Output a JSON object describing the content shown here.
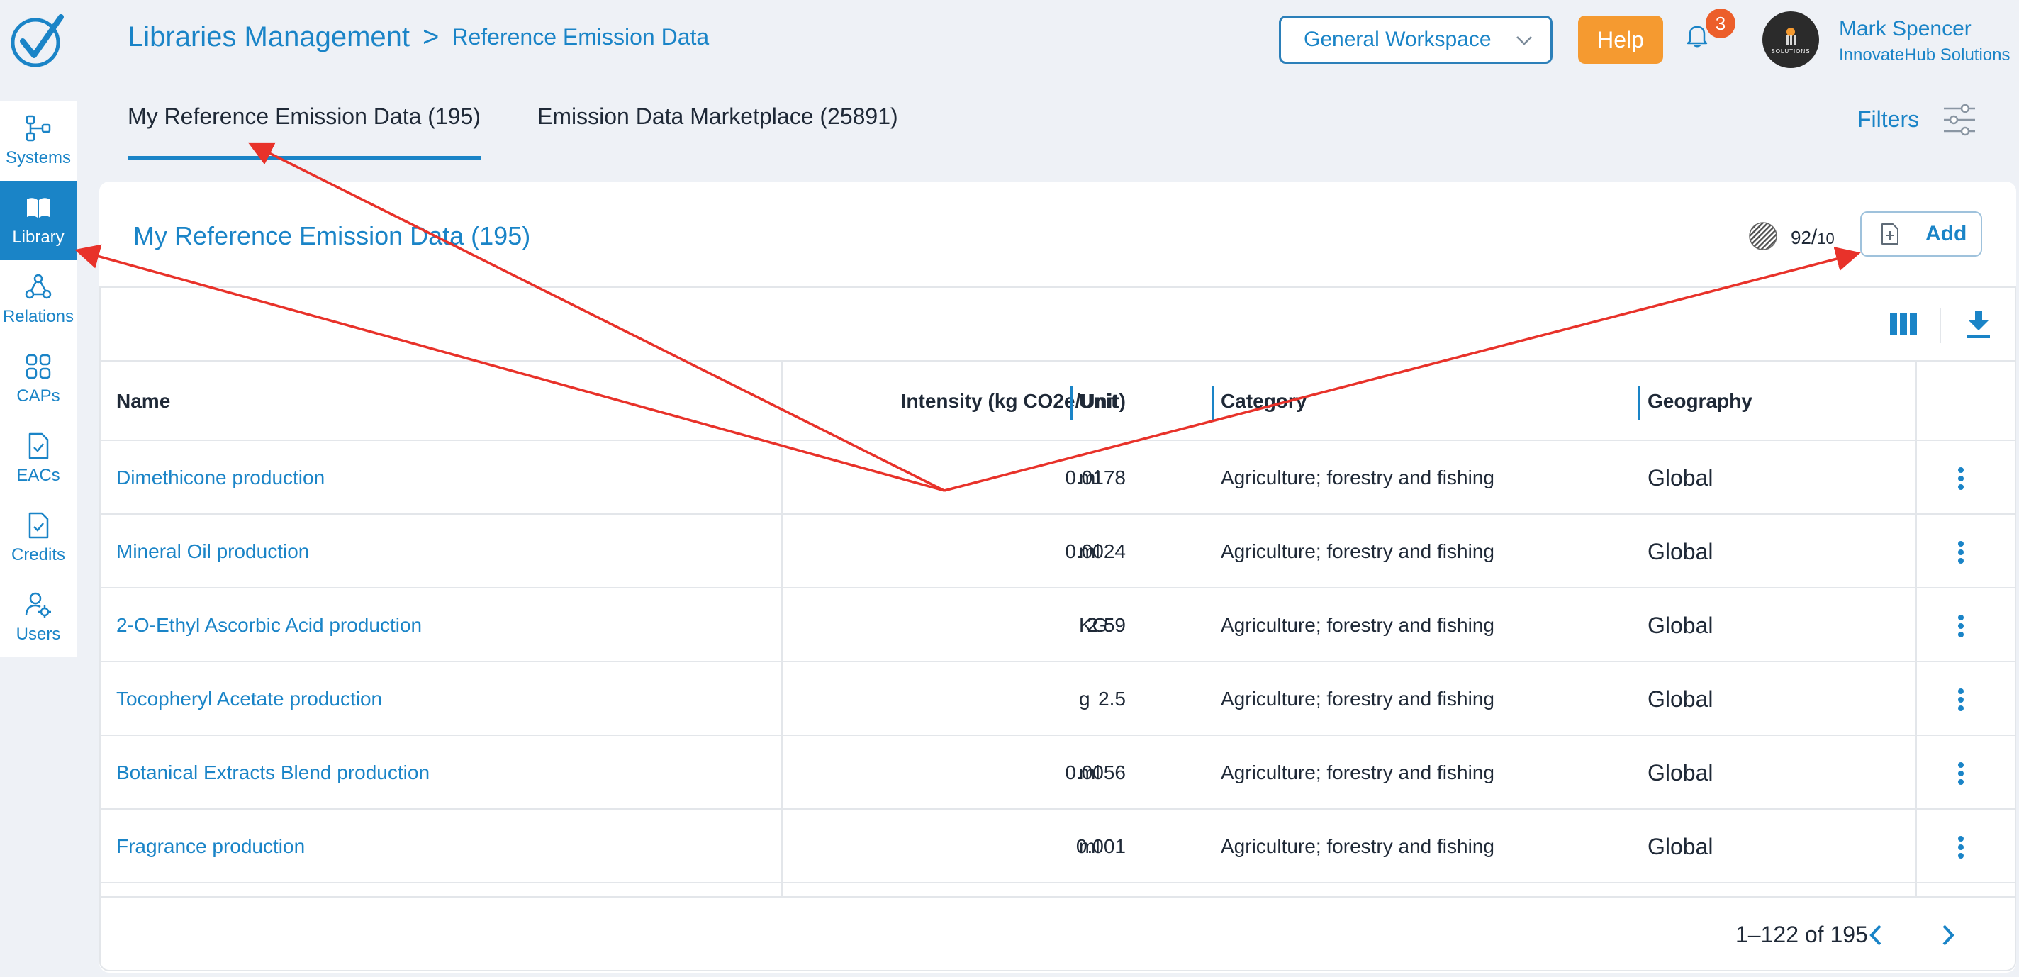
{
  "header": {
    "breadcrumb_root": "Libraries Management",
    "breadcrumb_separator": ">",
    "breadcrumb_current": "Reference Emission Data",
    "workspace": "General Workspace",
    "help_label": "Help",
    "notification_count": "3",
    "user_name": "Mark Spencer",
    "user_org": "InnovateHub Solutions",
    "avatar_text": "SOLUTIONS"
  },
  "sidebar": {
    "items": [
      {
        "label": "Systems",
        "icon": "systems-icon"
      },
      {
        "label": "Library",
        "icon": "book-icon"
      },
      {
        "label": "Relations",
        "icon": "relations-icon"
      },
      {
        "label": "CAPs",
        "icon": "caps-icon"
      },
      {
        "label": "EACs",
        "icon": "eacs-icon"
      },
      {
        "label": "Credits",
        "icon": "credits-icon"
      },
      {
        "label": "Users",
        "icon": "users-icon"
      }
    ],
    "active_index": 1
  },
  "tabs": [
    {
      "label": "My Reference Emission Data (195)",
      "active": true
    },
    {
      "label": "Emission Data Marketplace (25891)",
      "active": false
    }
  ],
  "filters_label": "Filters",
  "card": {
    "title": "My Reference Emission Data (195)",
    "quota_used": "92",
    "quota_sep": "/",
    "quota_total": "10",
    "add_label": "Add"
  },
  "table": {
    "columns": [
      "Name",
      "Intensity (kg CO2e/Unit)",
      "Unit",
      "Category",
      "Geography"
    ],
    "rows": [
      {
        "name": "Dimethicone production",
        "intensity": "0.0178",
        "unit": "ml",
        "category": "Agriculture; forestry and fishing",
        "geography": "Global"
      },
      {
        "name": "Mineral Oil production",
        "intensity": "0.0024",
        "unit": "ml",
        "category": "Agriculture; forestry and fishing",
        "geography": "Global"
      },
      {
        "name": "2-O-Ethyl Ascorbic Acid production",
        "intensity": "2.59",
        "unit": "KG",
        "category": "Agriculture; forestry and fishing",
        "geography": "Global"
      },
      {
        "name": "Tocopheryl Acetate production",
        "intensity": "2.5",
        "unit": "g",
        "category": "Agriculture; forestry and fishing",
        "geography": "Global"
      },
      {
        "name": "Botanical Extracts Blend production",
        "intensity": "0.0056",
        "unit": "ml",
        "category": "Agriculture; forestry and fishing",
        "geography": "Global"
      },
      {
        "name": "Fragrance production",
        "intensity": "0.001",
        "unit": "ml",
        "category": "Agriculture; forestry and fishing",
        "geography": "Global"
      }
    ],
    "pagination": "1–122 of 195"
  },
  "colors": {
    "accent": "#1a84c7",
    "help": "#f59a30",
    "badge": "#ec5e2a",
    "annotation": "#e8322a"
  }
}
